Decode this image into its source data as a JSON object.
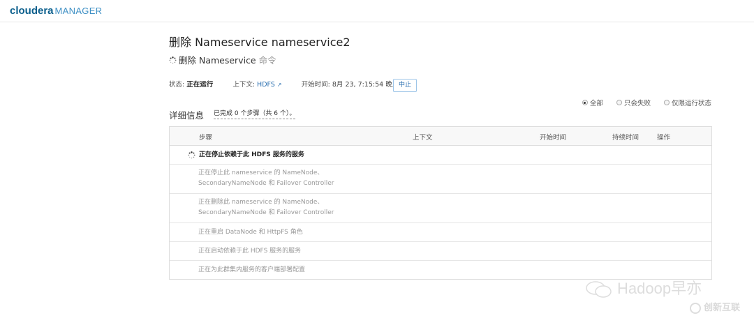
{
  "header": {
    "brand_main": "cloudera",
    "brand_sub": "MANAGER"
  },
  "page": {
    "title": "删除 Nameservice nameservice2",
    "command_label": "删除 Nameservice",
    "command_suffix": "命令"
  },
  "status": {
    "status_label": "状态:",
    "status_value": "正在运行",
    "context_label": "上下文:",
    "context_value": "HDFS",
    "start_label": "开始时间:",
    "start_value": "8月 23, 7:15:54 晚上",
    "abort_button": "中止"
  },
  "filters": {
    "options": [
      "全部",
      "只会失败",
      "仅限运行状态"
    ],
    "selected": "全部"
  },
  "details": {
    "label": "详细信息",
    "progress": "已完成 0 个步骤（共 6 个）。"
  },
  "table": {
    "columns": [
      "步骤",
      "上下文",
      "开始时间",
      "持续时间",
      "操作"
    ],
    "group": "正在停止依赖于此 HDFS 服务的服务",
    "steps": [
      "正在停止此 nameservice 的 NameNode、SecondaryNameNode 和 Failover Controller",
      "正在删除此 nameservice 的 NameNode、SecondaryNameNode 和 Failover Controller",
      "正在重启 DataNode 和 HttpFS 角色",
      "正在启动依赖于此 HDFS 服务的服务",
      "正在为此群集内服务的客户端部署配置"
    ]
  },
  "watermark": {
    "text1": "Hadoop早亦",
    "text2": "创新互联"
  }
}
